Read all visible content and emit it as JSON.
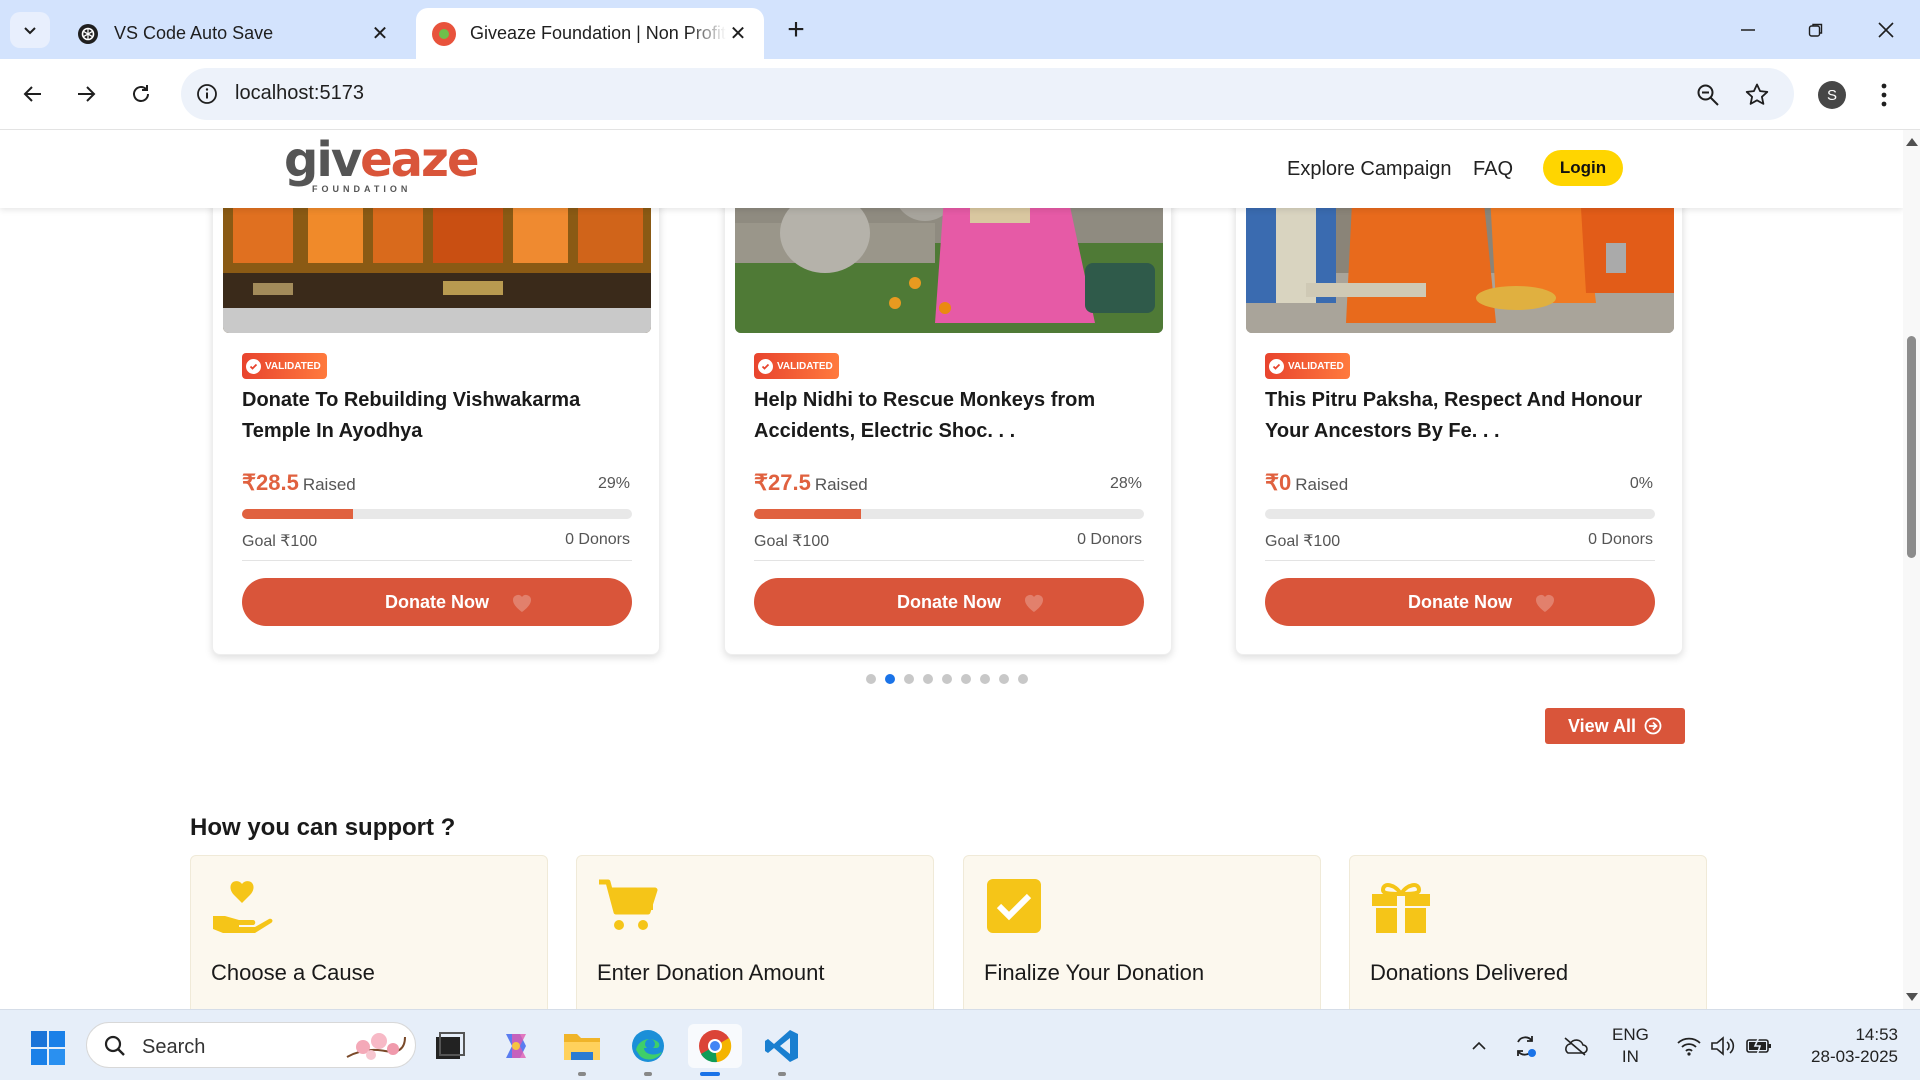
{
  "browser": {
    "tabs": [
      {
        "title": "VS Code Auto Save",
        "active": false
      },
      {
        "title": "Giveaze Foundation | Non Profit Organization",
        "active": true
      }
    ],
    "url": "localhost:5173",
    "profile_initial": "S"
  },
  "site": {
    "logo": {
      "word_main": "giv",
      "word_accent": "eaze",
      "subtitle": "FOUNDATION"
    },
    "nav": {
      "explore": "Explore Campaign",
      "faq": "FAQ",
      "login": "Login"
    },
    "badge_label": "VALIDATED",
    "raised_suffix": "Raised",
    "donate_label": "Donate Now",
    "campaigns": [
      {
        "title": "Donate To Rebuilding Vishwakarma Temple In Ayodhya",
        "raised": "₹28.5",
        "percent": "29%",
        "progress": 0.285,
        "goal": "Goal ₹100",
        "donors": "0 Donors"
      },
      {
        "title": "Help Nidhi to Rescue Monkeys from Accidents, Electric Shoc. . .",
        "raised": "₹27.5",
        "percent": "28%",
        "progress": 0.275,
        "goal": "Goal ₹100",
        "donors": "0 Donors"
      },
      {
        "title": "This Pitru Paksha, Respect And Honour Your Ancestors By Fe. . .",
        "raised": "₹0",
        "percent": "0%",
        "progress": 0,
        "goal": "Goal ₹100",
        "donors": "0 Donors"
      }
    ],
    "carousel": {
      "total": 9,
      "active_index": 1
    },
    "view_all": "View All",
    "support": {
      "title": "How you can support ?",
      "steps": [
        {
          "label": "Choose a Cause",
          "icon": "hand-heart-icon"
        },
        {
          "label": "Enter Donation Amount",
          "icon": "cart-icon"
        },
        {
          "label": "Finalize Your Donation",
          "icon": "checkbox-icon"
        },
        {
          "label": "Donations Delivered",
          "icon": "gift-icon"
        }
      ]
    },
    "colors": {
      "accent": "#d9553a",
      "login": "#ffd500",
      "step_icon": "#f5c518"
    }
  },
  "taskbar": {
    "search_placeholder": "Search",
    "lang_line1": "ENG",
    "lang_line2": "IN",
    "time": "14:53",
    "date": "28-03-2025"
  }
}
